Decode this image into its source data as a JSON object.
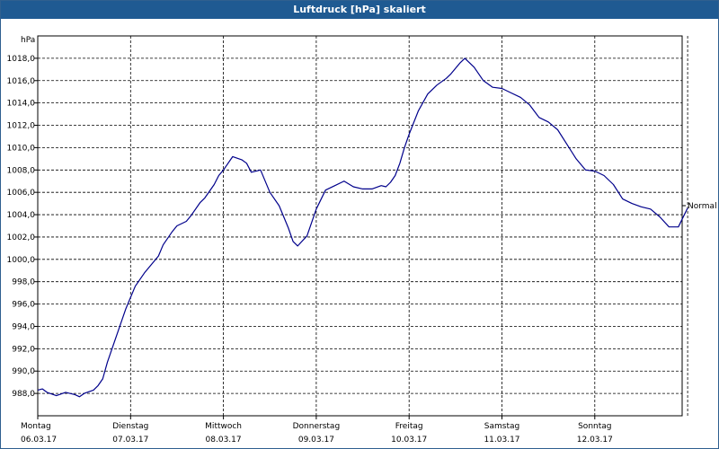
{
  "window": {
    "title": "Luftdruck [hPa] skaliert"
  },
  "chart_data": {
    "type": "line",
    "title": "Luftdruck [hPa] skaliert",
    "ylabel": "hPa",
    "xlabel": "",
    "x_unit": "days since Montag 06.03.17 00:00",
    "xlim": [
      0,
      7
    ],
    "ylim": [
      986.0,
      1020.0
    ],
    "yticks": [
      988.0,
      990.0,
      992.0,
      994.0,
      996.0,
      998.0,
      1000.0,
      1002.0,
      1004.0,
      1006.0,
      1008.0,
      1010.0,
      1012.0,
      1014.0,
      1016.0,
      1018.0
    ],
    "ytick_labels": [
      "988,0",
      "990,0",
      "992,0",
      "994,0",
      "996,0",
      "998,0",
      "1000,0",
      "1002,0",
      "1004,0",
      "1006,0",
      "1008,0",
      "1010,0",
      "1012,0",
      "1014,0",
      "1016,0",
      "1018,0"
    ],
    "xticks": [
      {
        "day": "Montag",
        "date": "06.03.17"
      },
      {
        "day": "Dienstag",
        "date": "07.03.17"
      },
      {
        "day": "Mittwoch",
        "date": "08.03.17"
      },
      {
        "day": "Donnerstag",
        "date": "09.03.17"
      },
      {
        "day": "Freitag",
        "date": "10.03.17"
      },
      {
        "day": "Samstag",
        "date": "11.03.17"
      },
      {
        "day": "Sonntag",
        "date": "12.03.17"
      }
    ],
    "annotation": "Normal",
    "grid": true,
    "series": [
      {
        "color": "#00008b",
        "x": [
          0.0,
          0.05,
          0.1,
          0.2,
          0.3,
          0.4,
          0.45,
          0.5,
          0.6,
          0.65,
          0.7,
          0.75,
          0.85,
          0.95,
          1.05,
          1.15,
          1.2,
          1.3,
          1.35,
          1.45,
          1.5,
          1.6,
          1.65,
          1.75,
          1.8,
          1.9,
          1.95,
          2.0,
          2.1,
          2.2,
          2.25,
          2.3,
          2.4,
          2.5,
          2.6,
          2.7,
          2.75,
          2.8,
          2.9,
          3.0,
          3.1,
          3.2,
          3.3,
          3.4,
          3.5,
          3.6,
          3.7,
          3.75,
          3.8,
          3.85,
          3.9,
          3.95,
          4.0,
          4.1,
          4.2,
          4.3,
          4.4,
          4.45,
          4.5,
          4.55,
          4.6,
          4.7,
          4.8,
          4.9,
          5.0,
          5.1,
          5.2,
          5.3,
          5.4,
          5.5,
          5.6,
          5.7,
          5.8,
          5.9,
          6.0,
          6.1,
          6.2,
          6.3,
          6.4,
          6.5,
          6.55,
          6.6,
          6.7,
          6.8,
          6.9,
          7.0
        ],
        "values": [
          988.3,
          988.4,
          988.1,
          987.8,
          988.1,
          987.9,
          987.7,
          988.0,
          988.3,
          988.7,
          989.3,
          990.8,
          993.2,
          995.6,
          997.6,
          998.8,
          999.3,
          1000.3,
          1001.3,
          1002.5,
          1003.0,
          1003.4,
          1003.9,
          1005.1,
          1005.5,
          1006.7,
          1007.5,
          1008.0,
          1009.2,
          1008.9,
          1008.6,
          1007.8,
          1008.0,
          1006.0,
          1004.8,
          1002.8,
          1001.6,
          1001.2,
          1002.1,
          1004.5,
          1006.2,
          1006.6,
          1007.0,
          1006.5,
          1006.3,
          1006.3,
          1006.6,
          1006.5,
          1006.9,
          1007.5,
          1008.6,
          1010.0,
          1011.2,
          1013.3,
          1014.8,
          1015.6,
          1016.2,
          1016.6,
          1017.1,
          1017.6,
          1018.0,
          1017.2,
          1016.0,
          1015.4,
          1015.3,
          1014.9,
          1014.5,
          1013.8,
          1012.7,
          1012.3,
          1011.6,
          1010.3,
          1009.0,
          1008.0,
          1007.9,
          1007.5,
          1006.7,
          1005.4,
          1005.0,
          1004.7,
          1004.6,
          1004.5,
          1003.8,
          1002.9,
          1002.9,
          1004.6
        ]
      }
    ]
  }
}
